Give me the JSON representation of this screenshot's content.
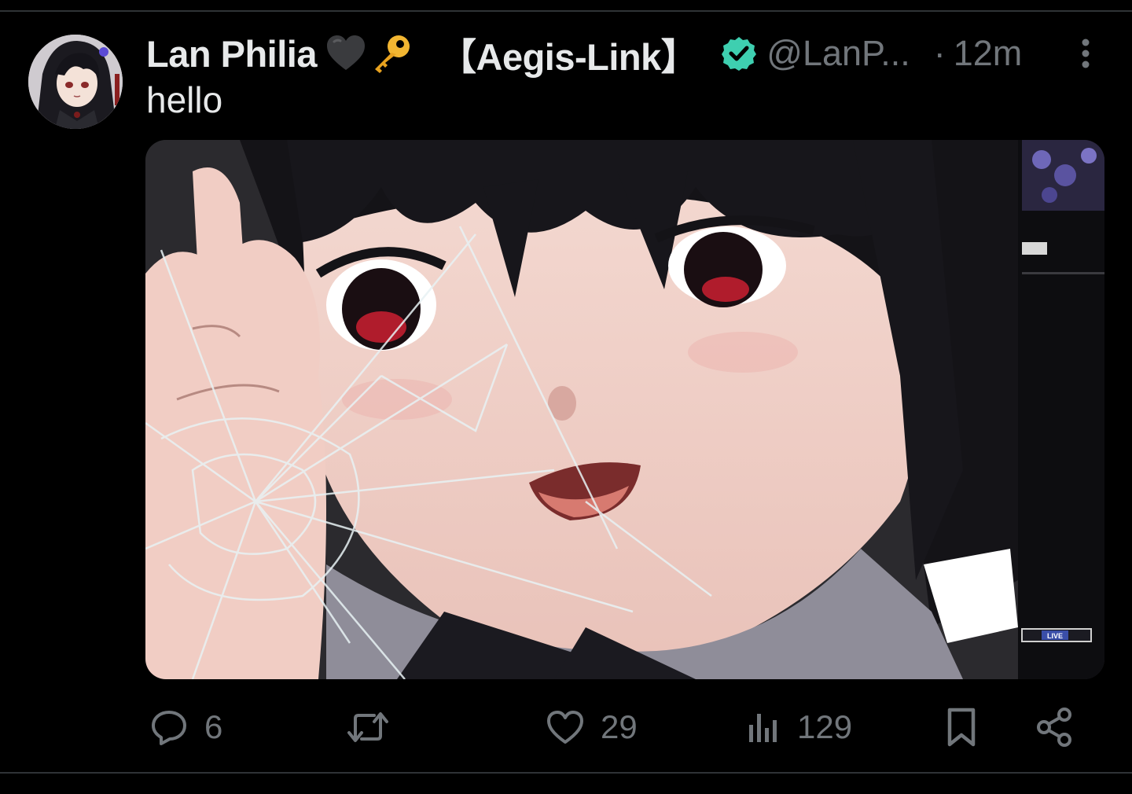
{
  "tweet": {
    "author": {
      "display_name": "Lan Philia",
      "name_emojis": [
        "black-heart-icon",
        "key-icon"
      ],
      "affiliation": "【Aegis-Link】",
      "verified": true,
      "handle": "@LanP...",
      "avatar": "anime-character-avatar"
    },
    "separator": "·",
    "timestamp": "12m",
    "text": "hello",
    "media": {
      "type": "image",
      "description_icon": "anime-girl-broken-glass-image",
      "overlay_labels": [
        "LIVE"
      ]
    },
    "actions": {
      "reply": {
        "icon": "reply-icon",
        "count": "6"
      },
      "retweet": {
        "icon": "retweet-icon",
        "count": ""
      },
      "like": {
        "icon": "heart-icon",
        "count": "29"
      },
      "views": {
        "icon": "views-icon",
        "count": "129"
      },
      "bookmark": {
        "icon": "bookmark-icon"
      },
      "share": {
        "icon": "share-icon"
      }
    }
  },
  "colors": {
    "background": "#000000",
    "primary_text": "#e7e9ea",
    "secondary_text": "#71767b",
    "divider": "#2f3336",
    "verified_badge": "#3ecfb0"
  }
}
